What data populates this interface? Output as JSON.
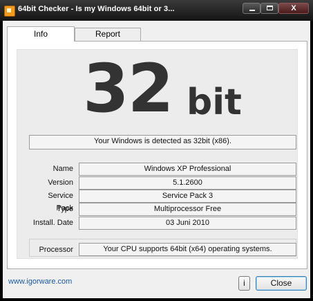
{
  "window": {
    "title": "64bit Checker - Is my Windows 64bit or 3..."
  },
  "tabs": [
    {
      "label": "Info"
    },
    {
      "label": "Report"
    }
  ],
  "result": {
    "number": "32",
    "unit": "bit",
    "detected_text": "Your Windows is detected as 32bit (x86)."
  },
  "details": [
    {
      "label": "Name",
      "value": "Windows XP Professional"
    },
    {
      "label": "Version",
      "value": "5.1.2600"
    },
    {
      "label": "Service Pack",
      "value": "Service Pack 3"
    },
    {
      "label": "Type",
      "value": "Multiprocessor Free"
    },
    {
      "label": "Install. Date",
      "value": "03 Juni 2010"
    }
  ],
  "processor": {
    "label": "Processor",
    "value": "Your CPU supports 64bit (x64) operating systems."
  },
  "footer": {
    "link_text": "www.igorware.com",
    "info_button": "i",
    "close_button": "Close"
  },
  "caption_buttons": {
    "close_glyph": "X"
  }
}
